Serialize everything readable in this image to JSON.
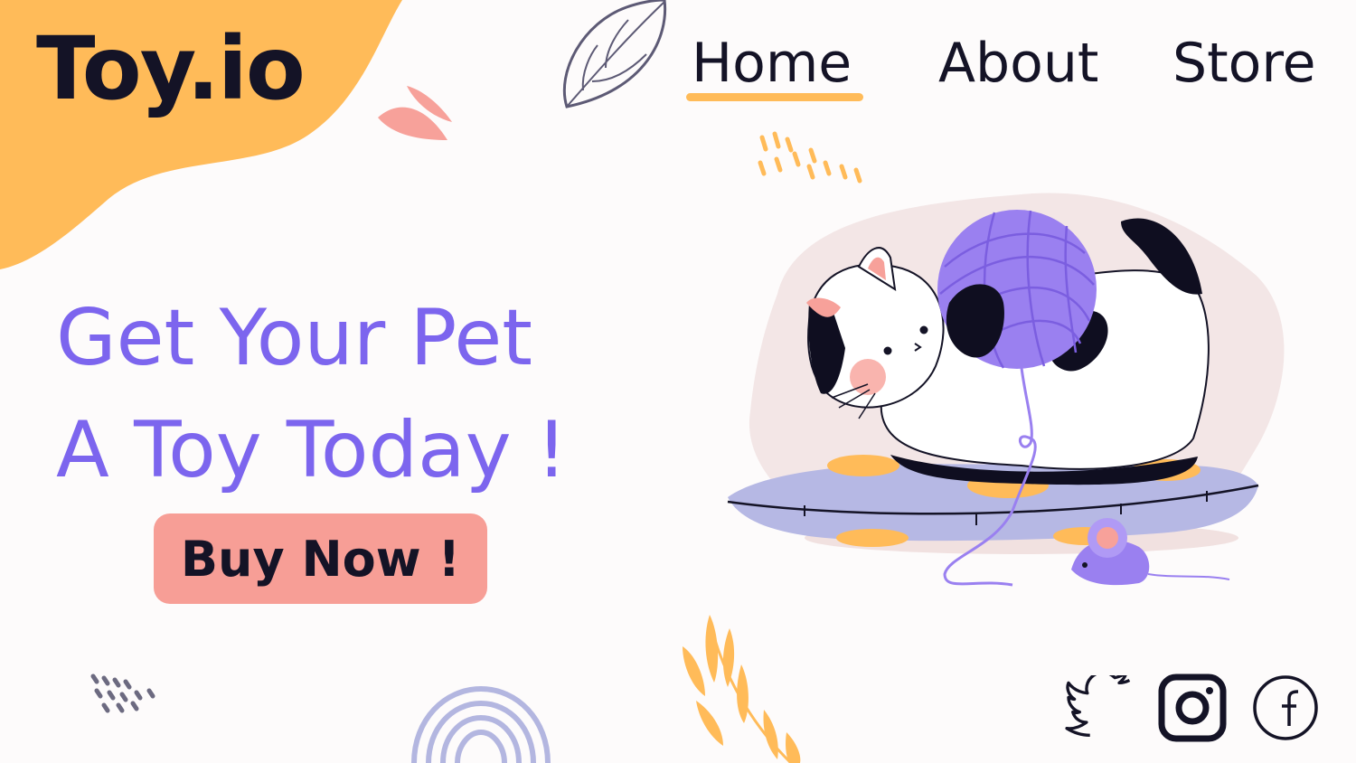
{
  "brand": {
    "name": "Toy.io"
  },
  "nav": {
    "home": "Home",
    "about": "About",
    "store": "Store",
    "active": "Home"
  },
  "hero": {
    "headline_line1": "Get Your Pet",
    "headline_line2": "A Toy Today !",
    "cta_label": "Buy Now !"
  },
  "social": [
    "twitter-icon",
    "instagram-icon",
    "facebook-icon"
  ],
  "colors": {
    "accent_orange": "#ffbb59",
    "headline_purple": "#7c65ee",
    "button_pink": "#f79e96",
    "text_dark": "#141326",
    "leaf_pink": "#f7a19a",
    "leaf_gray": "#6c6a80",
    "arch_lilac": "#b3b6e0",
    "cushion": "#b6b8e4",
    "yarn": "#9a80f0"
  },
  "illustration": "cat-with-yarn-on-cushion"
}
